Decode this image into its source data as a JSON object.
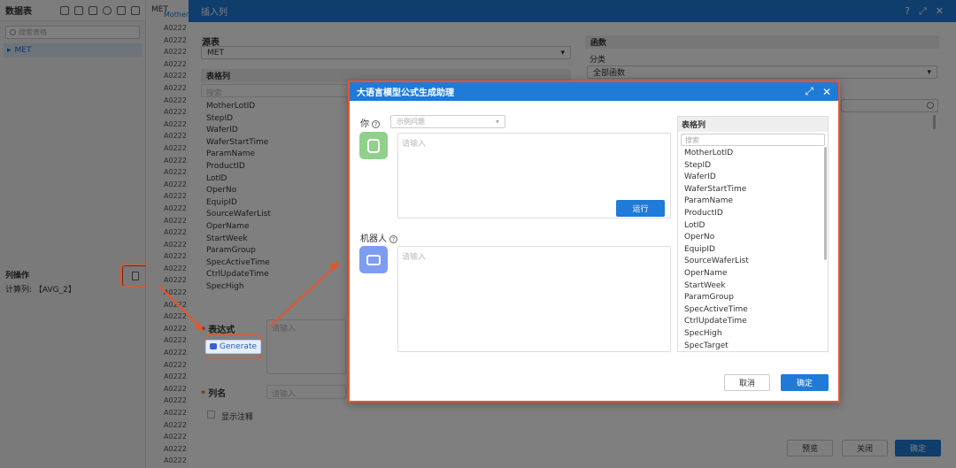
{
  "left_panel": {
    "title": "数据表",
    "search_placeholder": "搜索表格",
    "tree_item": "MET",
    "ops_title": "列操作",
    "calc_col": "计算列: 【AVG_2】"
  },
  "middle": {
    "tab": "MET",
    "header": "Mother",
    "rows": [
      "A0222",
      "A0222",
      "A0222",
      "A0222",
      "A0222",
      "A0222",
      "A0222",
      "A0222",
      "A0222",
      "A0222",
      "A0222",
      "A0222",
      "A0222",
      "A0222",
      "A0222",
      "A0222",
      "A0222",
      "A0222",
      "A0222",
      "A0222",
      "A0222",
      "A0222",
      "A0222",
      "A0222",
      "A0222",
      "A0222",
      "A0222",
      "A0222",
      "A0222",
      "A0222",
      "A0222",
      "A0222",
      "A0222",
      "A0222",
      "A0222",
      "A0222",
      "A0222"
    ]
  },
  "insert_dialog": {
    "title": "插入列",
    "source_table_label": "源表",
    "source_table_value": "MET",
    "table_cols_label": "表格列",
    "search_placeholder": "搜索",
    "columns": [
      "MotherLotID",
      "StepID",
      "WaferID",
      "WaferStartTime",
      "ParamName",
      "ProductID",
      "LotID",
      "OperNo",
      "EquipID",
      "SourceWaferList",
      "OperName",
      "StartWeek",
      "ParamGroup",
      "SpecActiveTime",
      "CtrlUpdateTime",
      "SpecHigh"
    ],
    "functions_label": "函数",
    "category_label": "分类",
    "category_value": "全部函数",
    "expression_label": "表达式",
    "generate_label": "Generate",
    "expression_placeholder": "请输入",
    "colname_label": "列名",
    "colname_placeholder": "请输入",
    "show_comment": "显示注释",
    "btn_preview": "预览",
    "btn_close": "关闭",
    "btn_ok": "确定"
  },
  "llm_dialog": {
    "title": "大语言模型公式生成助理",
    "you_label": "你",
    "example_placeholder": "示例问题",
    "input_placeholder": "请输入",
    "run_label": "运行",
    "bot_label": "机器人",
    "bot_placeholder": "请输入",
    "table_cols_label": "表格列",
    "search_placeholder": "搜索",
    "columns": [
      "MotherLotID",
      "StepID",
      "WaferID",
      "WaferStartTime",
      "ParamName",
      "ProductID",
      "LotID",
      "OperNo",
      "EquipID",
      "SourceWaferList",
      "OperName",
      "StartWeek",
      "ParamGroup",
      "SpecActiveTime",
      "CtrlUpdateTime",
      "SpecHigh",
      "SpecTarget"
    ],
    "btn_cancel": "取消",
    "btn_ok": "确定"
  },
  "colors": {
    "primary": "#1f7ad8",
    "highlight": "#e8542b"
  },
  "icons": [
    "help-icon",
    "expand-icon",
    "close-icon",
    "search-icon",
    "robot-icon",
    "user-icon",
    "chevron-down-icon"
  ]
}
